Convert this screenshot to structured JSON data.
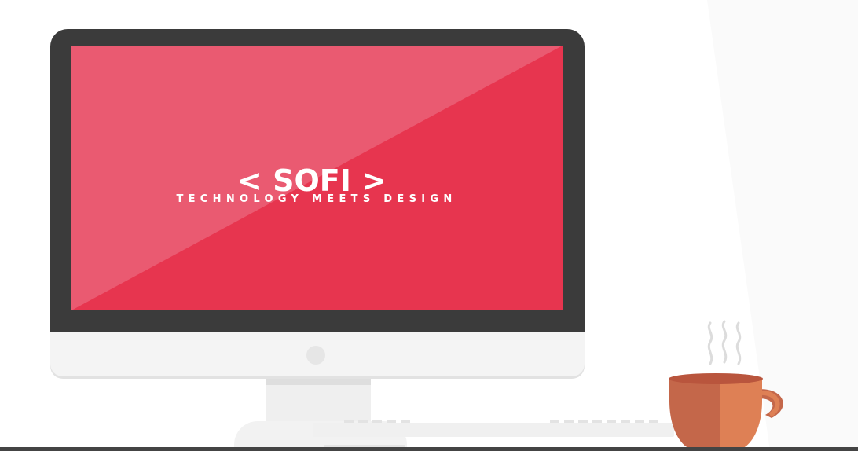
{
  "brand": {
    "name": "< SOFI >",
    "tagline": "TECHNOLOGY MEETS DESIGN"
  },
  "colors": {
    "screen": "#e7354f",
    "screen_gloss": "#ea5a71",
    "bezel": "#3b3b3b",
    "chin": "#f4f4f4",
    "cup_dark": "#c4674a",
    "cup_light": "#de8055",
    "cup_rim": "#b9553d"
  },
  "icons": {
    "steam": "steam-icon",
    "cup": "coffee-cup-icon",
    "chin_button": "power-button-icon"
  }
}
